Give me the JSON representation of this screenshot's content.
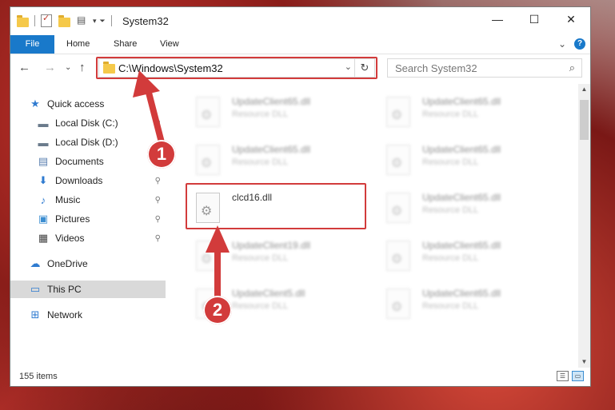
{
  "window": {
    "title": "System32"
  },
  "titlebar": {
    "minimize": "—",
    "maximize": "☐",
    "close": "✕"
  },
  "ribbon": {
    "tabs": [
      "File",
      "Home",
      "Share",
      "View"
    ],
    "expand": "⌄",
    "help": "?"
  },
  "address": {
    "path": "C:\\Windows\\System32",
    "dropdown": "⌄",
    "refresh": "↻"
  },
  "nav_buttons": {
    "back": "←",
    "forward": "→",
    "recent": "⌄",
    "up": "↑"
  },
  "search": {
    "placeholder": "Search System32",
    "icon": "⌕"
  },
  "nav_pane": {
    "items": [
      {
        "label": "Quick access",
        "icon": "star-icon",
        "glyph": "★",
        "color": "#2f7bd0"
      },
      {
        "label": "Local Disk (C:)",
        "icon": "drive-icon",
        "glyph": "▬",
        "color": "#6b7b8c",
        "pinned": true
      },
      {
        "label": "Local Disk (D:)",
        "icon": "drive-icon",
        "glyph": "▬",
        "color": "#6b7b8c"
      },
      {
        "label": "Documents",
        "icon": "documents-icon",
        "glyph": "▤",
        "color": "#5a7fb0",
        "pinned": true
      },
      {
        "label": "Downloads",
        "icon": "download-icon",
        "glyph": "⬇",
        "color": "#2f7bd0",
        "pinned": true
      },
      {
        "label": "Music",
        "icon": "music-icon",
        "glyph": "♪",
        "color": "#2f7bd0",
        "pinned": true
      },
      {
        "label": "Pictures",
        "icon": "pictures-icon",
        "glyph": "▣",
        "color": "#3c8ed1",
        "pinned": true
      },
      {
        "label": "Videos",
        "icon": "videos-icon",
        "glyph": "▦",
        "color": "#444444",
        "pinned": true
      },
      {
        "label": "OneDrive",
        "icon": "cloud-icon",
        "glyph": "☁",
        "color": "#2f7bd0"
      },
      {
        "label": "This PC",
        "icon": "computer-icon",
        "glyph": "▭",
        "color": "#2f7bd0",
        "selected": true
      },
      {
        "label": "Network",
        "icon": "network-icon",
        "glyph": "⊞",
        "color": "#2f7bd0"
      }
    ],
    "pin_glyph": "📌"
  },
  "files": [
    {
      "name": "UpdateClient65.dll",
      "type": "Resource DLL",
      "blurred": true
    },
    {
      "name": "UpdateClient65.dll",
      "type": "Resource DLL",
      "blurred": true
    },
    {
      "name": "UpdateClient65.dll",
      "type": "Resource DLL",
      "blurred": true
    },
    {
      "name": "UpdateClient65.dll",
      "type": "Resource DLL",
      "blurred": true
    },
    {
      "name": "clcd16.dll",
      "type": "",
      "blurred": false
    },
    {
      "name": "UpdateClient65.dll",
      "type": "Resource DLL",
      "blurred": true
    },
    {
      "name": "UpdateClient19.dll",
      "type": "Resource DLL",
      "blurred": true
    },
    {
      "name": "UpdateClient65.dll",
      "type": "Resource DLL",
      "blurred": true
    },
    {
      "name": "UpdateClient5.dll",
      "type": "Resource DLL",
      "blurred": true
    },
    {
      "name": "UpdateClient65.dll",
      "type": "Resource DLL",
      "blurred": true
    }
  ],
  "status": {
    "items_count": "155 items"
  },
  "callouts": {
    "step1": "1",
    "step2": "2"
  },
  "colors": {
    "accent": "#1979ca",
    "highlight": "#d23b3b"
  }
}
